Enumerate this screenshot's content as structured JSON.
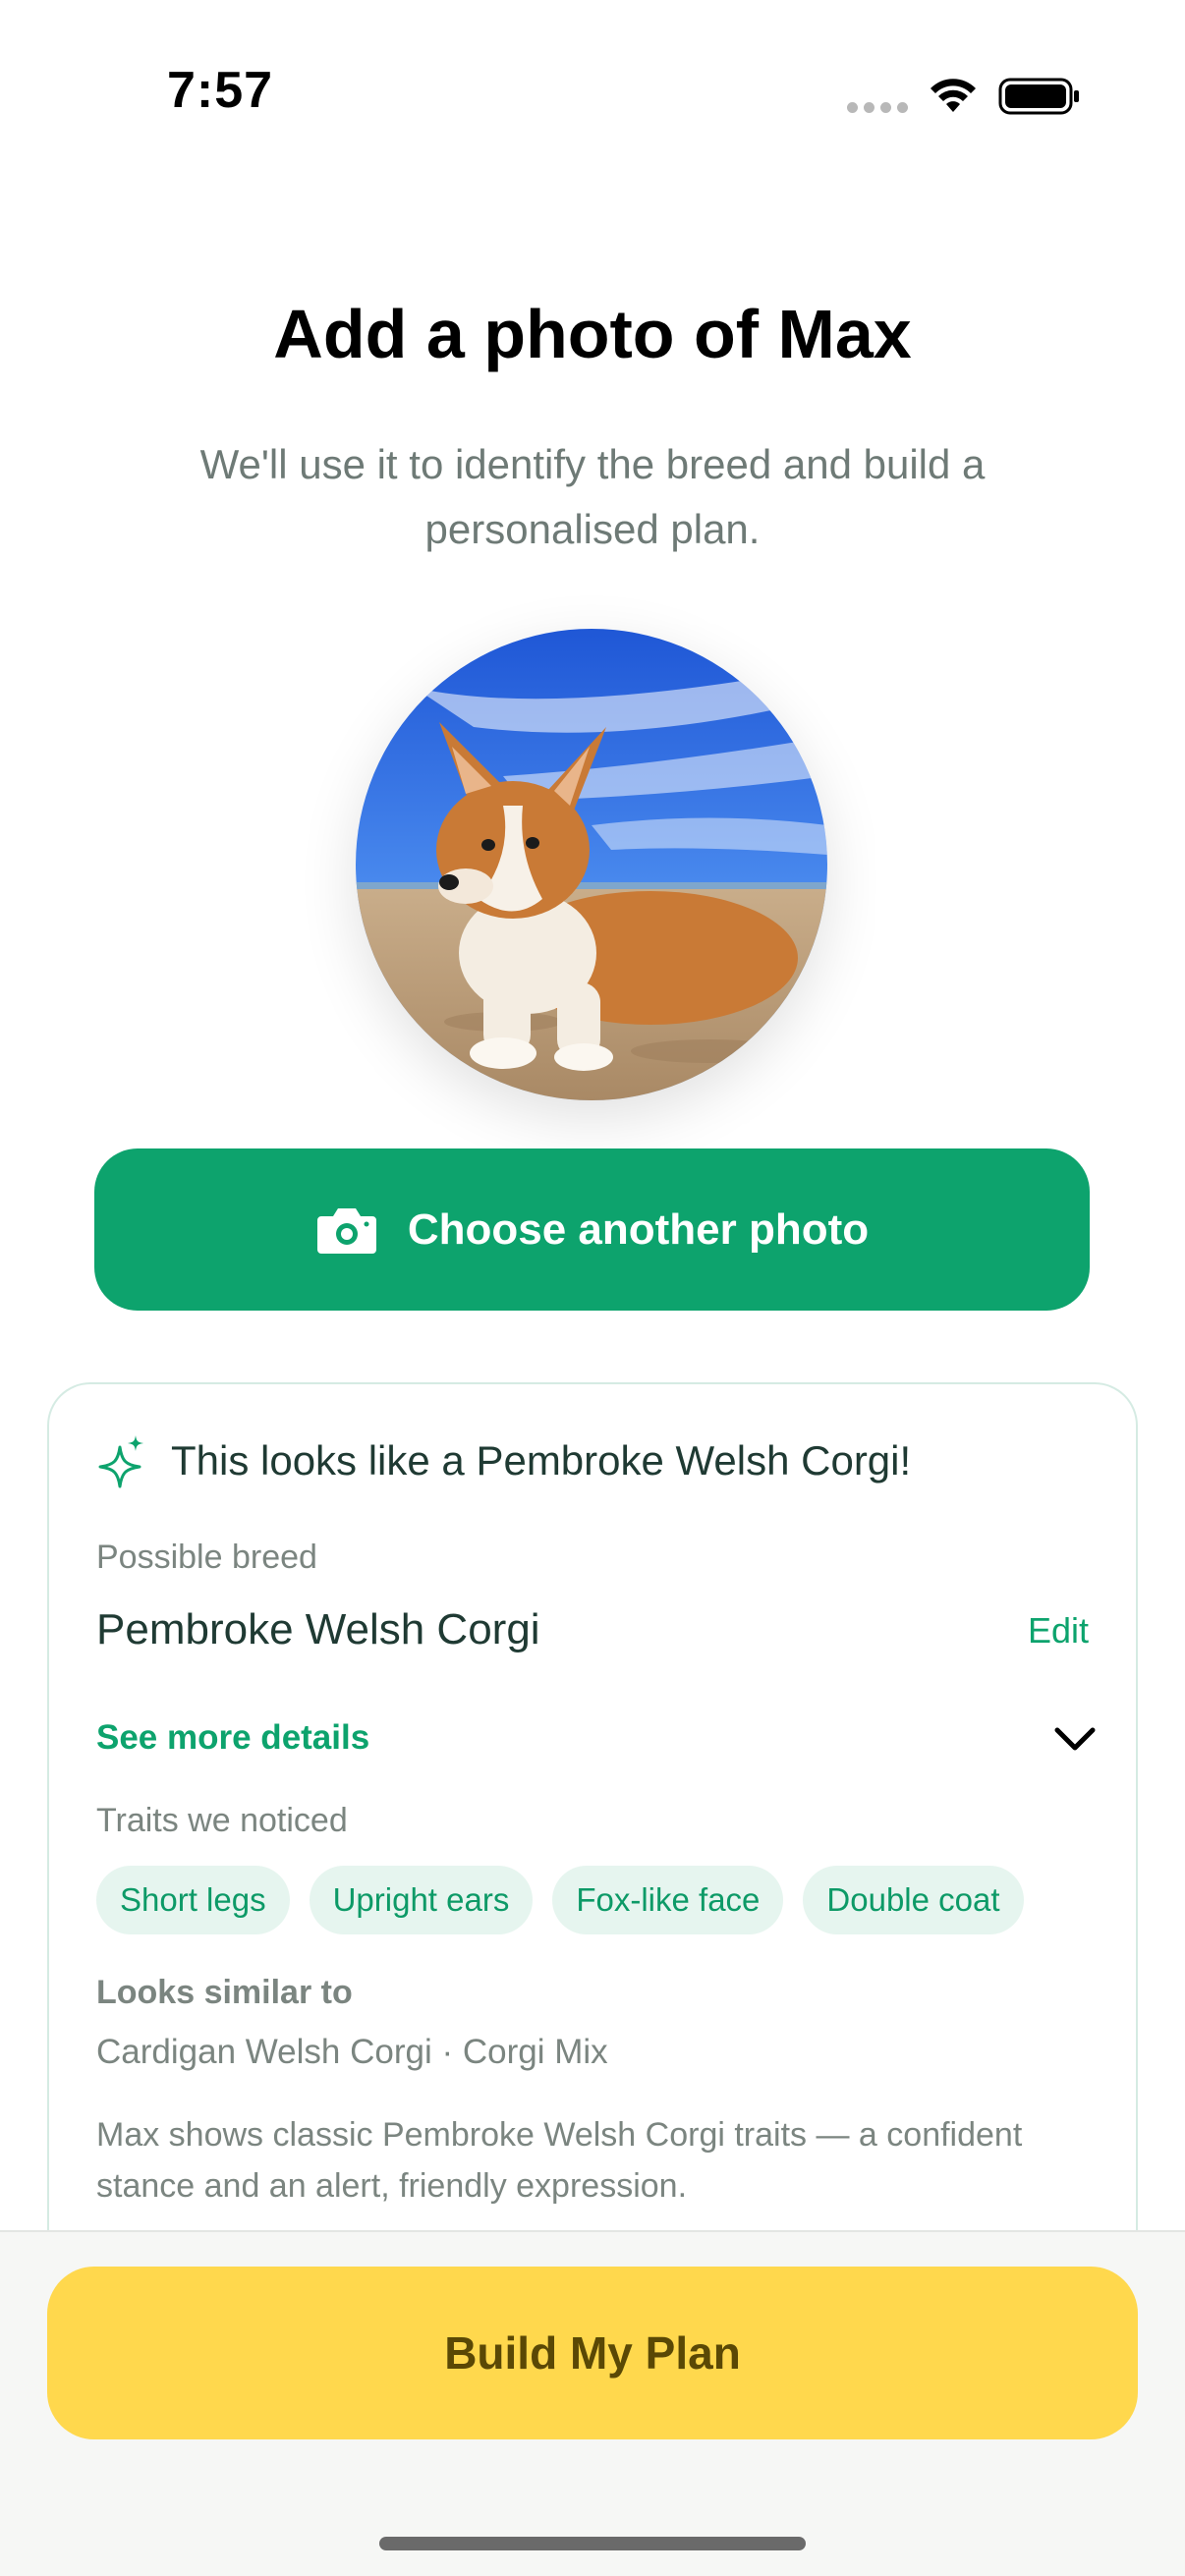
{
  "status_bar": {
    "time": "7:57"
  },
  "header": {
    "title": "Add a photo of Max",
    "subtitle": "We'll use it to identify the breed and build a personalised plan."
  },
  "photo": {
    "subject": "corgi-on-beach-photo"
  },
  "choose_button": {
    "label": "Choose another photo",
    "icon": "camera-icon"
  },
  "result": {
    "title": "This looks like a Pembroke Welsh Corgi!",
    "possible_breed_label": "Possible breed",
    "breed": "Pembroke Welsh Corgi",
    "edit_label": "Edit",
    "see_more_label": "See more details",
    "traits_label": "Traits we noticed",
    "traits": [
      "Short legs",
      "Upright ears",
      "Fox-like face",
      "Double coat"
    ],
    "similar_label": "Looks similar to",
    "similar_value": "Cardigan Welsh Corgi · Corgi Mix",
    "description": "Max shows classic Pembroke Welsh Corgi traits — a confident stance and an alert, friendly expression."
  },
  "build_button": {
    "label": "Build My Plan"
  },
  "colors": {
    "primary_green": "#0da36d",
    "chip_bg": "#e6f5ef",
    "cta_yellow": "#ffd84d",
    "cta_text": "#5a4805"
  }
}
